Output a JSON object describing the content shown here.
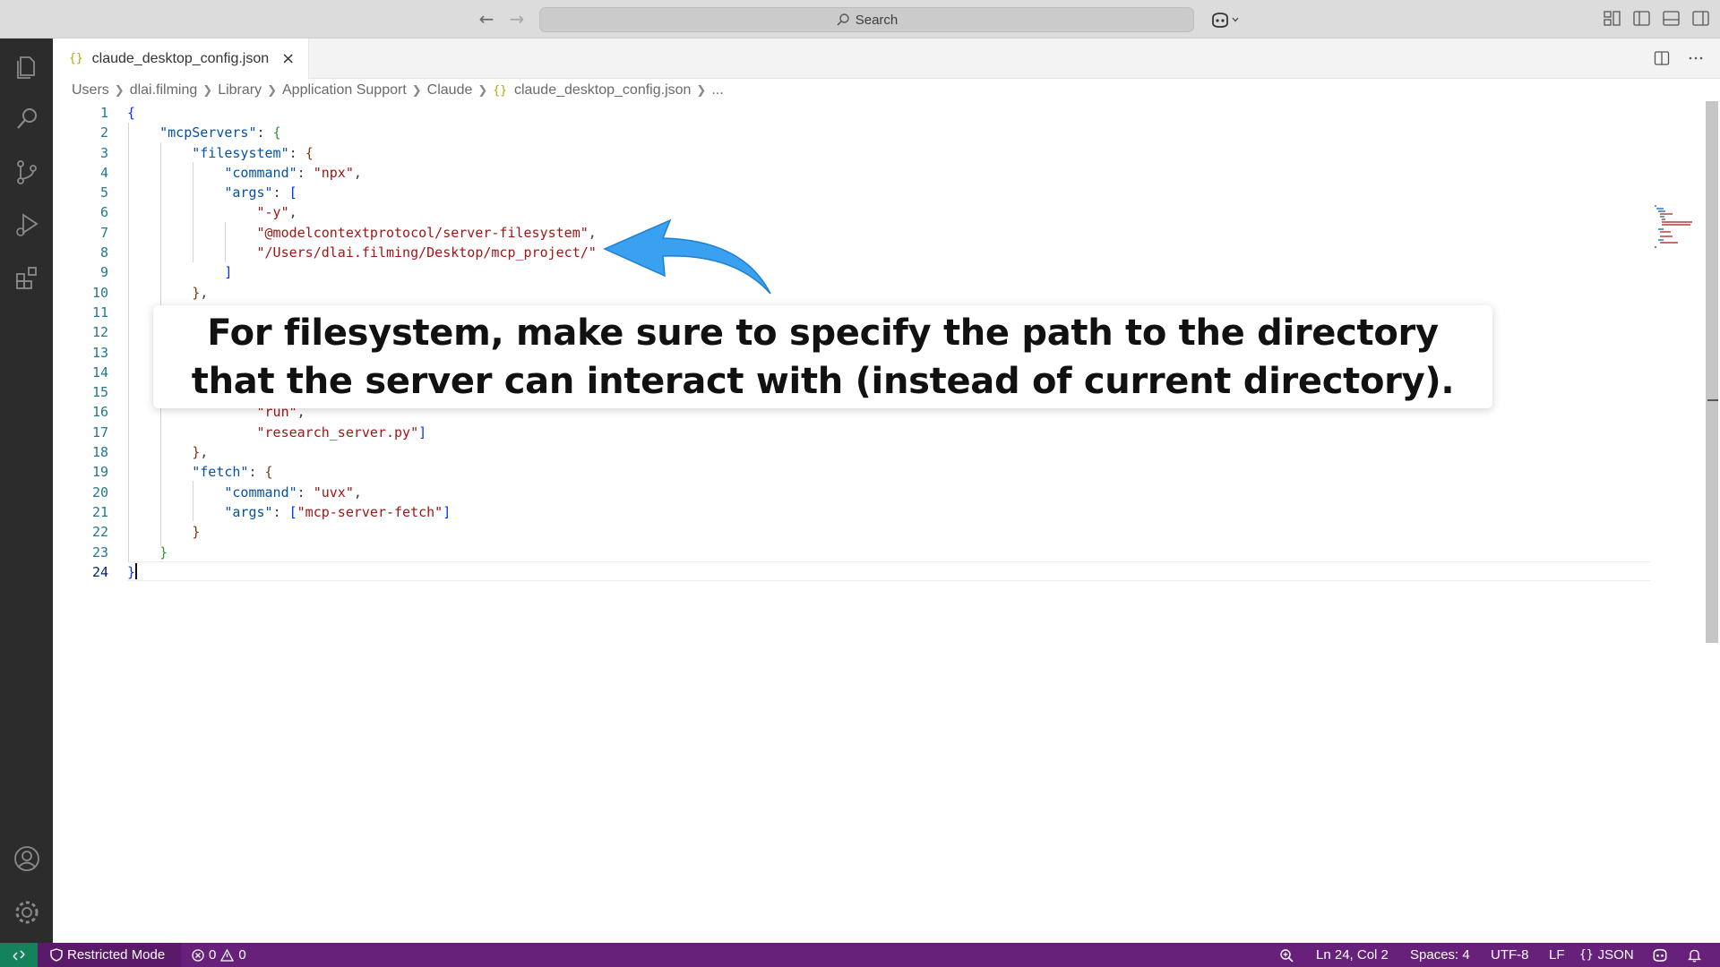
{
  "titlebar": {
    "search_label": "Search",
    "back_icon": "arrow-left-icon",
    "forward_icon": "arrow-right-icon"
  },
  "activity": [
    "explorer-icon",
    "search-icon",
    "source-control-icon",
    "run-debug-icon",
    "extensions-icon",
    "accounts-icon",
    "manage-gear-icon"
  ],
  "tab": {
    "icon": "{}",
    "label": "claude_desktop_config.json",
    "close": "×"
  },
  "breadcrumb": {
    "items": [
      "Users",
      "dlai.filming",
      "Library",
      "Application Support",
      "Claude"
    ],
    "file_icon": "{}",
    "file": "claude_desktop_config.json",
    "more": "..."
  },
  "editor": {
    "line_numbers": [
      "1",
      "2",
      "3",
      "4",
      "5",
      "6",
      "7",
      "8",
      "9",
      "10",
      "11",
      "12",
      "13",
      "14",
      "15",
      "16",
      "17",
      "18",
      "19",
      "20",
      "21",
      "22",
      "23",
      "24"
    ],
    "visible_code": {
      "l2_key": "\"mcpServers\"",
      "l3_key": "\"filesystem\"",
      "l4_key": "\"command\"",
      "l4_val": "\"npx\"",
      "l5_key": "\"args\"",
      "l6_val": "\"-y\"",
      "l7_val": "\"@modelcontextprotocol/server-filesystem\"",
      "l8_val": "\"/Users/dlai.filming/Desktop/mcp_project/\"",
      "l16_val": "\"run\"",
      "l17_val": "\"research_server.py\"",
      "l19_key": "\"fetch\"",
      "l20_key": "\"command\"",
      "l20_val": "\"uvx\"",
      "l21_key": "\"args\"",
      "l21_val": "\"mcp-server-fetch\""
    }
  },
  "annotation": {
    "line1": "For filesystem, make sure to specify the path to the directory",
    "line2": "that the server can  interact with (instead of current directory).",
    "arrow_color": "#3aa0f0"
  },
  "status": {
    "restricted": "Restricted Mode",
    "errors": "0",
    "warnings": "0",
    "position": "Ln 24, Col 2",
    "spaces": "Spaces: 4",
    "encoding": "UTF-8",
    "eol": "LF",
    "lang_icon": "{}",
    "language": "JSON",
    "accent": "#68217a",
    "remote_color": "#16825d"
  }
}
